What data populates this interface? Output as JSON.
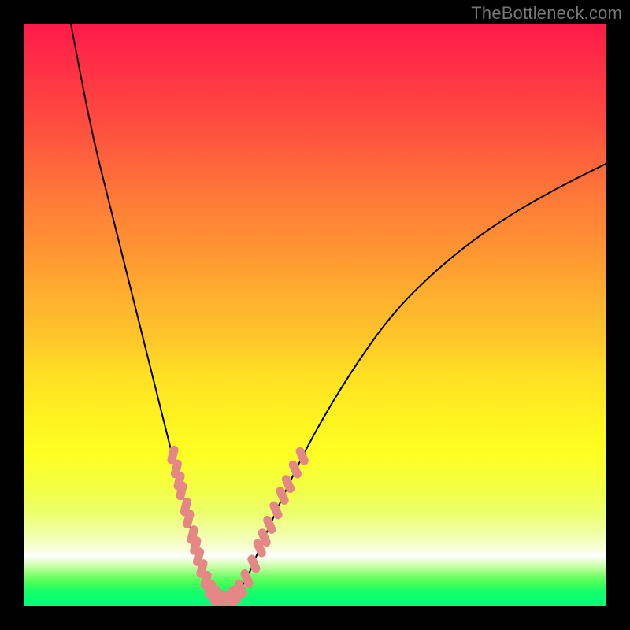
{
  "watermark": "TheBottleneck.com",
  "colors": {
    "frame_bg": "#000000",
    "curve_color": "#000000",
    "marker_color": "#e68787",
    "gradient_top": "#ff1a49",
    "gradient_bottom": "#00ff7b"
  },
  "chart_data": {
    "type": "line",
    "title": "",
    "xlabel": "",
    "ylabel": "",
    "xlim": [
      0,
      100
    ],
    "ylim": [
      0,
      100
    ],
    "grid": false,
    "axes_visible": false,
    "description": "Bottleneck curve: a steep asymmetric V. Left branch descends from upper-left, reaches a near-zero minimum around x≈33, then a shallower right branch rises toward the upper-right. Background is a vertical red→yellow→green gradient. Salmon dotted markers highlight portions of both branches near the bottom.",
    "curve": [
      {
        "x": 8.1,
        "y": 100.0
      },
      {
        "x": 10.0,
        "y": 90.0
      },
      {
        "x": 12.0,
        "y": 80.0
      },
      {
        "x": 14.5,
        "y": 70.0
      },
      {
        "x": 17.0,
        "y": 60.0
      },
      {
        "x": 19.5,
        "y": 50.0
      },
      {
        "x": 22.0,
        "y": 40.0
      },
      {
        "x": 24.5,
        "y": 30.0
      },
      {
        "x": 27.0,
        "y": 20.0
      },
      {
        "x": 29.5,
        "y": 10.0
      },
      {
        "x": 31.5,
        "y": 4.0
      },
      {
        "x": 33.0,
        "y": 1.5
      },
      {
        "x": 34.5,
        "y": 1.0
      },
      {
        "x": 36.0,
        "y": 1.5
      },
      {
        "x": 38.0,
        "y": 4.0
      },
      {
        "x": 40.5,
        "y": 10.0
      },
      {
        "x": 45.0,
        "y": 20.0
      },
      {
        "x": 50.0,
        "y": 30.0
      },
      {
        "x": 56.0,
        "y": 40.0
      },
      {
        "x": 63.0,
        "y": 50.0
      },
      {
        "x": 71.0,
        "y": 58.0
      },
      {
        "x": 80.0,
        "y": 65.0
      },
      {
        "x": 90.0,
        "y": 71.0
      },
      {
        "x": 100.0,
        "y": 76.0
      }
    ],
    "markers_left": [
      {
        "x": 25.6,
        "y": 26.0
      },
      {
        "x": 26.2,
        "y": 23.6
      },
      {
        "x": 26.7,
        "y": 21.5
      },
      {
        "x": 27.1,
        "y": 19.8
      },
      {
        "x": 27.8,
        "y": 17.1
      },
      {
        "x": 28.3,
        "y": 15.0
      },
      {
        "x": 29.0,
        "y": 12.3
      },
      {
        "x": 29.5,
        "y": 10.4
      },
      {
        "x": 30.0,
        "y": 8.5
      },
      {
        "x": 30.6,
        "y": 6.5
      },
      {
        "x": 31.3,
        "y": 4.5
      },
      {
        "x": 32.0,
        "y": 3.0
      },
      {
        "x": 32.8,
        "y": 2.0
      },
      {
        "x": 33.5,
        "y": 1.3
      },
      {
        "x": 34.3,
        "y": 1.0
      }
    ],
    "markers_right": [
      {
        "x": 35.5,
        "y": 1.3
      },
      {
        "x": 36.3,
        "y": 2.0
      },
      {
        "x": 37.3,
        "y": 3.0
      },
      {
        "x": 38.3,
        "y": 4.8
      },
      {
        "x": 39.5,
        "y": 7.3
      },
      {
        "x": 40.5,
        "y": 10.0
      },
      {
        "x": 41.3,
        "y": 11.8
      },
      {
        "x": 42.2,
        "y": 14.0
      },
      {
        "x": 43.3,
        "y": 16.5
      },
      {
        "x": 44.4,
        "y": 19.0
      },
      {
        "x": 45.4,
        "y": 21.0
      },
      {
        "x": 46.6,
        "y": 23.5
      },
      {
        "x": 47.8,
        "y": 25.8
      }
    ]
  }
}
